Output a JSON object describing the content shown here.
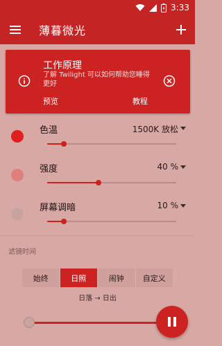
{
  "status": {
    "time": "3:33"
  },
  "app_bar": {
    "title": "薄暮微光"
  },
  "card": {
    "title": "工作原理",
    "description": "了解 Twilight 可以如何帮助您睡得更好",
    "preview_label": "预览",
    "tutorial_label": "教程"
  },
  "settings": [
    {
      "label": "色温",
      "value": "1500K 放松",
      "level": 0.13,
      "dot_color": "#e02020"
    },
    {
      "label": "强度",
      "value": "40 %",
      "level": 0.4,
      "dot_color": "#e07f7a"
    },
    {
      "label": "屏幕调暗",
      "value": "10 %",
      "level": 0.13,
      "dot_color": "#c9a3a0"
    }
  ],
  "filter_time": {
    "section_label": "滤镜时间",
    "options": [
      "始终",
      "日照",
      "闹钟",
      "自定义"
    ],
    "selected": "日照",
    "range_text": "日落 → 日出"
  },
  "colors": {
    "primary": "#c42424",
    "accent": "#cc2222",
    "background": "#d8a8a4"
  },
  "icons": [
    "wifi-icon",
    "signal-icon",
    "battery-icon",
    "menu-icon",
    "add-icon",
    "info-icon",
    "close-icon",
    "pause-icon"
  ]
}
